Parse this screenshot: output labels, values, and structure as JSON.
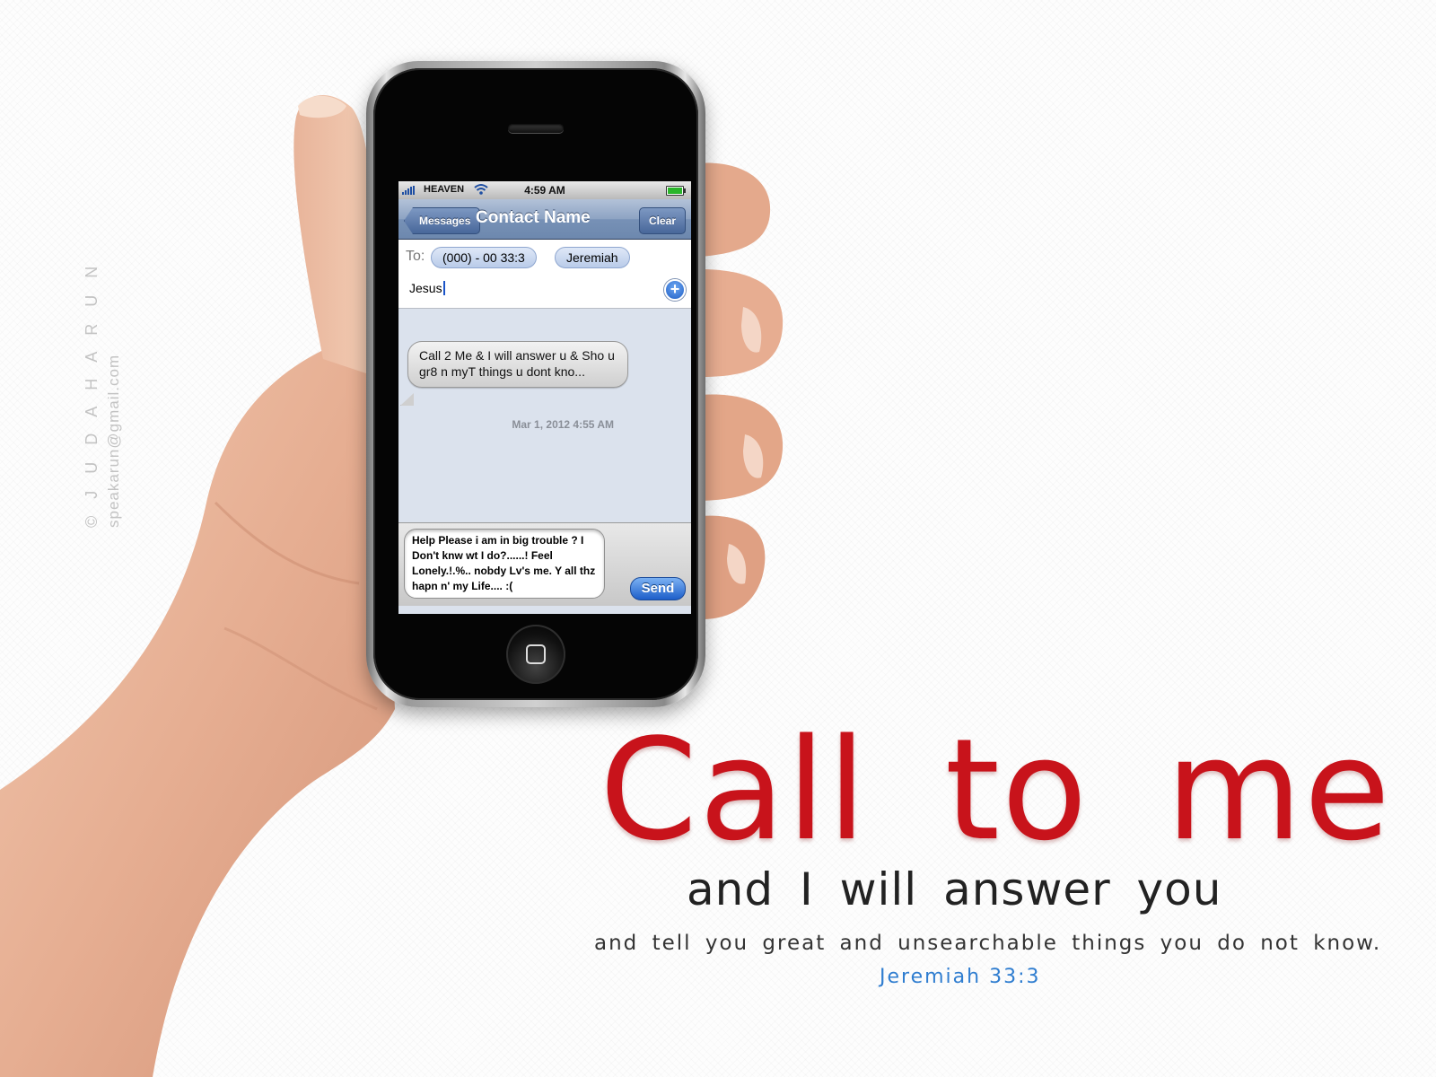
{
  "status_bar": {
    "carrier": "HEAVEN",
    "time": "4:59 AM"
  },
  "nav_bar": {
    "back_label": "Messages",
    "title": "Contact Name",
    "clear_label": "Clear"
  },
  "recipients": {
    "to_label": "To:",
    "chips": [
      "(000) - 00  33:3",
      "Jeremiah"
    ],
    "typed_value": "Jesus"
  },
  "conversation": {
    "received_message": "Call 2 Me & I will answer u & Sho u gr8 n myT things u dont kno...",
    "timestamp": "Mar 1, 2012 4:55 AM"
  },
  "compose": {
    "draft_text": "Help Please i am in big trouble ? I Don't knw wt I do?......! Feel Lonely.!.%.. nobdy Lv's me. Y all thz hapn n' my Life.... :(",
    "send_label": "Send"
  },
  "watermark": {
    "name": "© J U D A H   A R U N",
    "email": "speakarun@gmail.com"
  },
  "poster": {
    "headline": "Call to me",
    "subline": "and I will answer you",
    "tagline": "and tell you great and unsearchable things  you do not know.",
    "reference": "Jeremiah 33:3"
  },
  "colors": {
    "headline": "#c8131b",
    "reference": "#2f7dd0",
    "nav_bar": "#7791b6",
    "send_button": "#1d5ec9"
  },
  "icons": {
    "signal": "signal-bars-icon",
    "wifi": "wifi-icon",
    "battery": "battery-icon",
    "add_contact": "plus-circle-icon",
    "home": "home-button-icon"
  }
}
